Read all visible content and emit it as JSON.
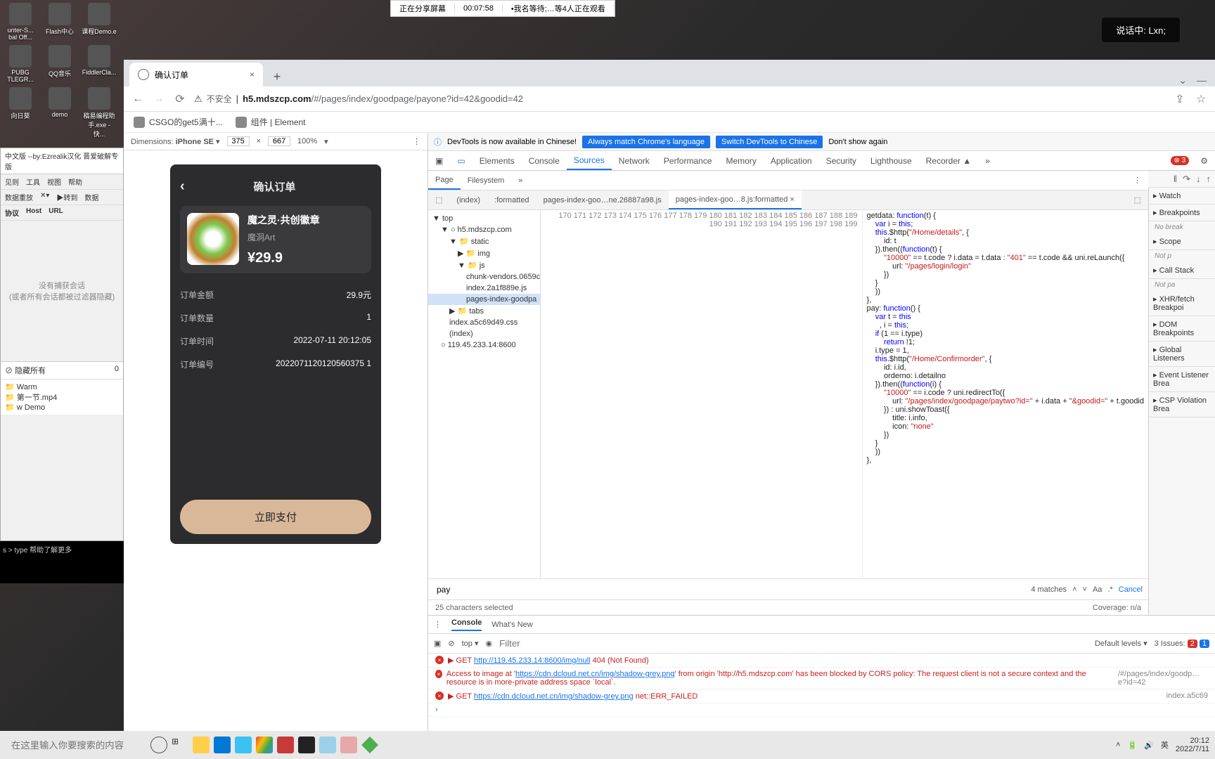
{
  "sharebar": {
    "status": "正在分享屏幕",
    "timer": "00:07:58",
    "viewers": "•我名等待;…等4人正在观看"
  },
  "voice": "说话中: Lxn;",
  "desktop_icons": [
    {
      "label": "unter-S... bal Off..."
    },
    {
      "label": "Flash中心"
    },
    {
      "label": "课程Demo.e"
    },
    {
      "label": "PUBG TLEGR..."
    },
    {
      "label": "QQ音乐"
    },
    {
      "label": "FiddlerCla..."
    },
    {
      "label": "向日葵"
    },
    {
      "label": "demo"
    },
    {
      "label": "稿易编程助手.exe - 快..."
    }
  ],
  "browser": {
    "tab": {
      "title": "确认订单"
    },
    "url": {
      "warn": "不安全",
      "host": "h5.mdszcp.com",
      "path": "/#/pages/index/goodpage/payone?id=42&goodid=42"
    },
    "bookmarks": [
      {
        "label": "CSGO的get5满十..."
      },
      {
        "label": "组件 | Element"
      }
    ]
  },
  "devicebar": {
    "label": "Dimensions:",
    "device": "iPhone SE",
    "w": "375",
    "x": "×",
    "h": "667",
    "zoom": "100%"
  },
  "phone": {
    "title": "确认订单",
    "product": {
      "name": "魔之灵·共创徽章",
      "author": "魔洞Art",
      "price": "¥29.9"
    },
    "rows": [
      {
        "k": "订单金额",
        "v": "29.9元"
      },
      {
        "k": "订单数量",
        "v": "1"
      },
      {
        "k": "订单时间",
        "v": "2022-07-11 20:12:05"
      },
      {
        "k": "订单编号",
        "v": "2022071120120560375 1"
      }
    ],
    "paybtn": "立即支付"
  },
  "devtools": {
    "infobar": {
      "text": "DevTools is now available in Chinese!",
      "b1": "Always match Chrome's language",
      "b2": "Switch DevTools to Chinese",
      "b3": "Don't show again"
    },
    "tabs": [
      "Elements",
      "Console",
      "Sources",
      "Network",
      "Performance",
      "Memory",
      "Application",
      "Security",
      "Lighthouse",
      "Recorder ▲"
    ],
    "active_tab": "Sources",
    "err_badge": "3",
    "src_top_tabs": [
      "Page",
      "Filesystem"
    ],
    "open_files": [
      "(index)",
      ":formatted",
      "pages-index-goo…ne.26887a98.js",
      "pages-index-goo…8.js:formatted"
    ],
    "active_file": "pages-index-goo…8.js:formatted",
    "tree": [
      {
        "t": "▼ top",
        "cls": ""
      },
      {
        "t": "▼ ○ h5.mdszcp.com",
        "cls": "ind1"
      },
      {
        "t": "▼ 📁 static",
        "cls": "ind2"
      },
      {
        "t": "▶ 📁 img",
        "cls": "ind3"
      },
      {
        "t": "▼ 📁 js",
        "cls": "ind3"
      },
      {
        "t": "chunk-vendors.0659c",
        "cls": "ind4"
      },
      {
        "t": "index.2a1f889e.js",
        "cls": "ind4"
      },
      {
        "t": "pages-index-goodpa",
        "cls": "ind4 sel"
      },
      {
        "t": "▶ 📁 tabs",
        "cls": "ind2"
      },
      {
        "t": "index.a5c69d49.css",
        "cls": "ind2"
      },
      {
        "t": "(index)",
        "cls": "ind2"
      },
      {
        "t": "○ 119.45.233.14:8600",
        "cls": "ind1"
      }
    ],
    "line_start": 170,
    "line_end": 199,
    "code": "getdata: function(t) {\n    var i = this;\n    this.$http(\"/Home/details\", {\n        id: t\n    }).then((function(t) {\n        \"10000\" == t.code ? i.data = t.data : \"401\" == t.code && uni.reLaunch({\n            url: \"/pages/login/login\"\n        })\n    }\n    ))\n},\npay: function() {\n    var t = this\n      , i = this;\n    if (1 == i.type)\n        return !1;\n    i.type = 1,\n    this.$http(\"/Home/Confirmorder\", {\n        id: i.id,\n        orderno: i.detailno\n    }).then((function(i) {\n        \"10000\" == i.code ? uni.redirectTo({\n            url: \"/pages/index/goodpage/paytwo?id=\" + i.data + \"&goodid=\" + t.goodid\n        }) : uni.showToast({\n            title: i.info,\n            icon: \"none\"\n        })\n    }\n    ))\n},",
    "search": {
      "q": "pay",
      "matches": "4 matches",
      "cancel": "Cancel"
    },
    "status": {
      "sel": "25 characters selected",
      "cov": "Coverage: n/a"
    },
    "rside": {
      "sections": [
        "Watch",
        "Breakpoints",
        "Scope",
        "Call Stack",
        "XHR/fetch Breakpoi",
        "DOM Breakpoints",
        "Global Listeners",
        "Event Listener Brea",
        "CSP Violation Brea"
      ],
      "empty": {
        "bp": "No break",
        "scope": "Not p",
        "cs": "Not pa"
      }
    }
  },
  "console": {
    "tabs": [
      "Console",
      "What's New"
    ],
    "toolbar": {
      "ctx": "top",
      "filter": "Filter",
      "levels": "Default levels",
      "issues_label": "3 Issues:",
      "issues_badges": [
        "2",
        "1"
      ]
    },
    "rows": [
      {
        "type": "err",
        "pre": "▶ GET ",
        "link": "http://119.45.233.14:8600/img/null",
        "post": " 404 (Not Found)",
        "rt": ""
      },
      {
        "type": "err",
        "pre": "Access to image at '",
        "link": "https://cdn.dcloud.net.cn/img/shadow-grey.png",
        "post": "' from origin 'http://h5.mdszcp.com' has been blocked by CORS policy: The request client is not a secure context and the resource is in more-private address space `local`.",
        "rt": "/#/pages/index/goodp…e?id=42"
      },
      {
        "type": "err",
        "pre": "▶ GET ",
        "link": "https://cdn.dcloud.net.cn/img/shadow-grey.png",
        "post": " net::ERR_FAILED",
        "rt": "index.a5c69"
      }
    ]
  },
  "fiddler": {
    "title": "中文版 --by:Ezrealik汉化 晋爱破解专版",
    "menu": [
      "见则",
      "工具",
      "视图",
      "帮助"
    ],
    "toolbar": [
      "数据重放",
      "✕▾",
      "▶转到",
      "数据"
    ],
    "cols": [
      "协议",
      "Host",
      "URL"
    ],
    "empty": "没有捕获会话\n(或者所有会话都被过滤器隐藏)",
    "status": {
      "hide": "隐藏所有",
      "count": "0"
    }
  },
  "explorer_files": [
    "Warm",
    "第一节.mp4",
    "w Demo"
  ],
  "cmd": "s > type 帮助了解更多",
  "taskbar": {
    "search_placeholder": "在这里输入你要搜索的内容",
    "ime": "英",
    "time": "20:12",
    "date": "2022/7/11"
  }
}
